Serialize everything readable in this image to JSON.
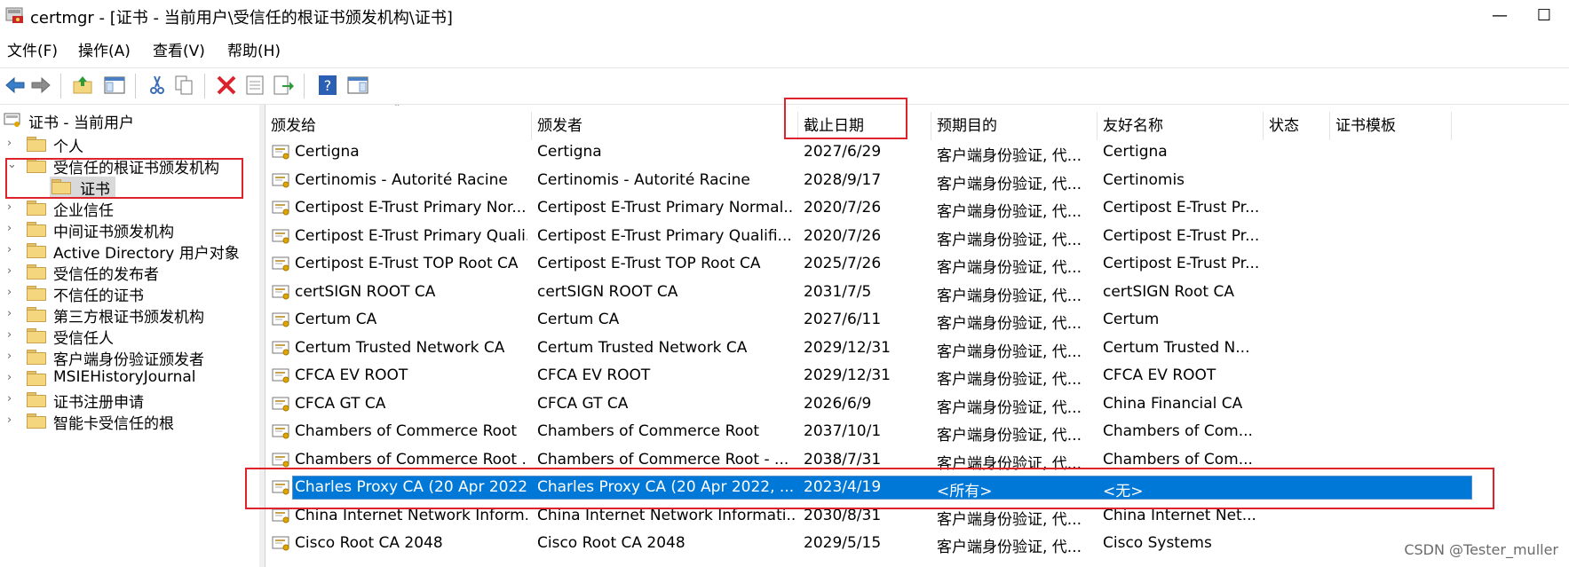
{
  "window": {
    "title": "certmgr - [证书 - 当前用户\\受信任的根证书颁发机构\\证书]",
    "minimize": "—",
    "maximize": "☐"
  },
  "menu": [
    "文件(F)",
    "操作(A)",
    "查看(V)",
    "帮助(H)"
  ],
  "toolbar": {
    "icons": [
      "back-arrow-icon",
      "forward-arrow-icon",
      "up-folder-icon",
      "show-hide-tree-icon",
      "cut-icon",
      "copy-icon",
      "delete-icon",
      "properties-icon",
      "export-list-icon",
      "help-icon",
      "action-pane-icon"
    ],
    "colors": {
      "delete": "#d9232d",
      "help": "#2b5fb4",
      "nav": "#3a7ec8"
    }
  },
  "tree": {
    "root": "证书 - 当前用户",
    "items": [
      {
        "label": "个人",
        "expanded": false
      },
      {
        "label": "受信任的根证书颁发机构",
        "expanded": true
      },
      {
        "label": "证书",
        "child": true
      },
      {
        "label": "企业信任",
        "expanded": false
      },
      {
        "label": "中间证书颁发机构",
        "expanded": false
      },
      {
        "label": "Active Directory 用户对象",
        "expanded": false
      },
      {
        "label": "受信任的发布者",
        "expanded": false
      },
      {
        "label": "不信任的证书",
        "expanded": false
      },
      {
        "label": "第三方根证书颁发机构",
        "expanded": false
      },
      {
        "label": "受信任人",
        "expanded": false
      },
      {
        "label": "客户端身份验证颁发者",
        "expanded": false
      },
      {
        "label": "MSIEHistoryJournal",
        "expanded": false
      },
      {
        "label": "证书注册申请",
        "expanded": false
      },
      {
        "label": "智能卡受信任的根",
        "expanded": false
      }
    ]
  },
  "columns": [
    "颁发给",
    "颁发者",
    "截止日期",
    "预期目的",
    "友好名称",
    "状态",
    "证书模板"
  ],
  "rows": [
    {
      "issued_to": "Certigna",
      "issuer": "Certigna",
      "expires": "2027/6/29",
      "purpose": "客户端身份验证, 代...",
      "friendly": "Certigna"
    },
    {
      "issued_to": "Certinomis - Autorité Racine",
      "issuer": "Certinomis - Autorité Racine",
      "expires": "2028/9/17",
      "purpose": "客户端身份验证, 代...",
      "friendly": "Certinomis"
    },
    {
      "issued_to": "Certipost E-Trust Primary Nor...",
      "issuer": "Certipost E-Trust Primary Normal...",
      "expires": "2020/7/26",
      "purpose": "客户端身份验证, 代...",
      "friendly": "Certipost E-Trust Pr..."
    },
    {
      "issued_to": "Certipost E-Trust Primary Quali...",
      "issuer": "Certipost E-Trust Primary Qualifi...",
      "expires": "2020/7/26",
      "purpose": "客户端身份验证, 代...",
      "friendly": "Certipost E-Trust Pr..."
    },
    {
      "issued_to": "Certipost E-Trust TOP Root CA",
      "issuer": "Certipost E-Trust TOP Root CA",
      "expires": "2025/7/26",
      "purpose": "客户端身份验证, 代...",
      "friendly": "Certipost E-Trust Pr..."
    },
    {
      "issued_to": "certSIGN ROOT CA",
      "issuer": "certSIGN ROOT CA",
      "expires": "2031/7/5",
      "purpose": "客户端身份验证, 代...",
      "friendly": "certSIGN Root CA"
    },
    {
      "issued_to": "Certum CA",
      "issuer": "Certum CA",
      "expires": "2027/6/11",
      "purpose": "客户端身份验证, 代...",
      "friendly": "Certum"
    },
    {
      "issued_to": "Certum Trusted Network CA",
      "issuer": "Certum Trusted Network CA",
      "expires": "2029/12/31",
      "purpose": "客户端身份验证, 代...",
      "friendly": "Certum Trusted N..."
    },
    {
      "issued_to": "CFCA EV ROOT",
      "issuer": "CFCA EV ROOT",
      "expires": "2029/12/31",
      "purpose": "客户端身份验证, 代...",
      "friendly": "CFCA EV ROOT"
    },
    {
      "issued_to": "CFCA GT CA",
      "issuer": "CFCA GT CA",
      "expires": "2026/6/9",
      "purpose": "客户端身份验证, 代...",
      "friendly": "China Financial CA"
    },
    {
      "issued_to": "Chambers of Commerce Root",
      "issuer": "Chambers of Commerce Root",
      "expires": "2037/10/1",
      "purpose": "客户端身份验证, 代...",
      "friendly": "Chambers of Com..."
    },
    {
      "issued_to": "Chambers of Commerce Root ...",
      "issuer": "Chambers of Commerce Root - ...",
      "expires": "2038/7/31",
      "purpose": "客户端身份验证, 代...",
      "friendly": "Chambers of Com..."
    },
    {
      "issued_to": "Charles Proxy CA (20 Apr 2022...",
      "issuer": "Charles Proxy CA (20 Apr 2022, ...",
      "expires": "2023/4/19",
      "purpose": "<所有>",
      "friendly": "<无>",
      "selected": true
    },
    {
      "issued_to": "China Internet Network Inform...",
      "issuer": "China Internet Network Informati...",
      "expires": "2030/8/31",
      "purpose": "客户端身份验证, 代...",
      "friendly": "China Internet Net..."
    },
    {
      "issued_to": "Cisco Root CA 2048",
      "issuer": "Cisco Root CA 2048",
      "expires": "2029/5/15",
      "purpose": "客户端身份验证, 代...",
      "friendly": "Cisco Systems"
    }
  ],
  "watermark": "CSDN @Tester_muller",
  "colors": {
    "selection": "#0078d7",
    "annotation": "#e0232b"
  }
}
